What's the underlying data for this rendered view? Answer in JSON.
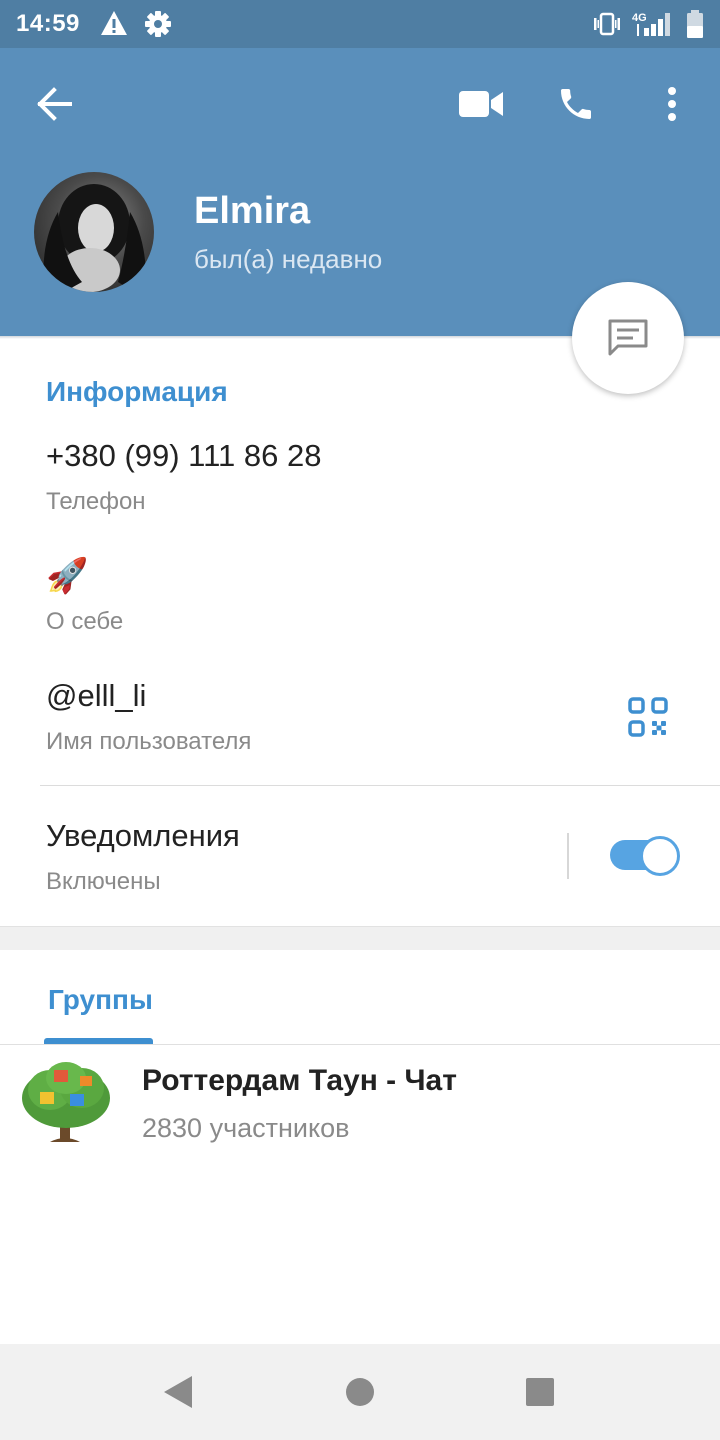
{
  "status_bar": {
    "time": "14:59",
    "icons": [
      "warning-icon",
      "settings-icon",
      "vibrate-icon",
      "4g-icon",
      "signal-icon",
      "battery-icon"
    ],
    "network": "4G"
  },
  "header": {
    "back_icon": "arrow-left-icon",
    "actions": [
      "video-call-icon",
      "phone-icon",
      "more-vert-icon"
    ],
    "contact_name": "Elmira",
    "contact_status": "был(а) недавно"
  },
  "info": {
    "title": "Информация",
    "phone_value": "+380 (99) 111 86 28",
    "phone_caption": "Телефон",
    "bio_value": "🚀",
    "bio_caption": "О себе",
    "username_value": "@elll_li",
    "username_caption": "Имя пользователя",
    "notifications_value": "Уведомления",
    "notifications_caption": "Включены",
    "notifications_enabled": true
  },
  "groups": {
    "title": "Группы",
    "items": [
      {
        "name": "Роттердам Таун - Чат",
        "members": "2830 участников"
      }
    ]
  },
  "colors": {
    "header": "#5a8fbb",
    "status_bar": "#4f7ea3",
    "accent": "#3e8fd0",
    "toggle": "#57a4e2"
  }
}
